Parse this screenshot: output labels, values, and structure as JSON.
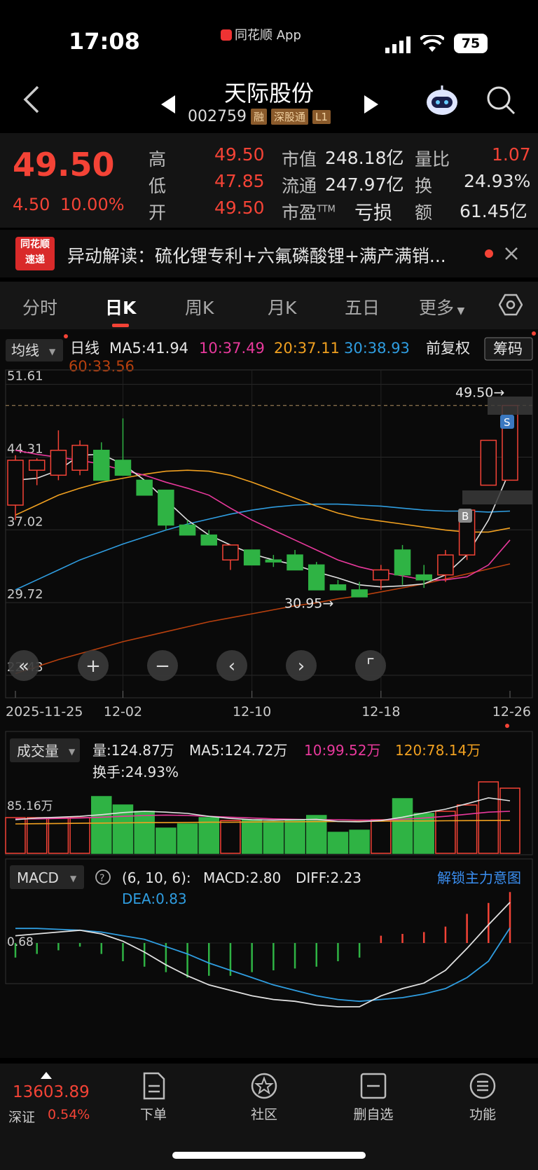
{
  "status_bar": {
    "time": "17:08",
    "app_label": "同花顺 App",
    "battery": "75"
  },
  "header": {
    "stock_name": "天际股份",
    "code": "002759",
    "tags": [
      "融",
      "深股通",
      "L1"
    ]
  },
  "quote": {
    "price": "49.50",
    "change": "4.50",
    "change_pct": "10.00%",
    "high_label": "高",
    "high": "49.50",
    "low_label": "低",
    "low": "47.85",
    "open_label": "开",
    "open": "49.50",
    "mktcap_label": "市值",
    "mktcap": "248.18亿",
    "float_label": "流通",
    "float": "247.97亿",
    "pe_label": "市盈",
    "pe_sup": "TTM",
    "pe": "亏损",
    "volratio_label": "量比",
    "volratio": "1.07",
    "turnover_label": "换",
    "turnover": "24.93%",
    "amount_label": "额",
    "amount": "61.45亿"
  },
  "banner": {
    "logo_top": "同花顺",
    "logo_bottom": "速递",
    "text": "异动解读：硫化锂专利+六氟磷酸锂+满产满销..."
  },
  "tabs": [
    "分时",
    "日K",
    "周K",
    "月K",
    "五日",
    "更多"
  ],
  "chart_header": {
    "indicator": "均线",
    "period": "日线",
    "ma5": "MA5:41.94",
    "ma10": "10:37.49",
    "ma20": "20:37.11",
    "ma30": "30:38.93",
    "ma60": "60:33.56",
    "adjust": "前复权",
    "chips": "筹码"
  },
  "price_axis": [
    "51.61",
    "44.31",
    "37.02",
    "29.72",
    "22.43"
  ],
  "price_marks": {
    "high_label": "49.50→",
    "low_label": "30.95→",
    "sell_marker": "S",
    "buy_marker": "B"
  },
  "date_axis": [
    "2025-11-25",
    "12-02",
    "12-10",
    "12-18",
    "12-26"
  ],
  "volume_header": {
    "indicator": "成交量",
    "vol": "量:124.87万",
    "ma5": "MA5:124.72万",
    "ma10": "10:99.52万",
    "ma120": "120:78.14万",
    "turnover": "换手:24.93%",
    "axis_label": "85.16万"
  },
  "macd_header": {
    "indicator": "MACD",
    "params": "(6, 10, 6):",
    "macd": "MACD:2.80",
    "diff": "DIFF:2.23",
    "dea": "DEA:0.83",
    "unlock": "解锁主力意图",
    "axis_label": "0.68"
  },
  "bottom_bar": {
    "index_value": "13603.89",
    "index_name": "深证",
    "index_pct": "0.54%",
    "items": [
      "下单",
      "社区",
      "删自选",
      "功能"
    ]
  },
  "colors": {
    "up": "#f44336",
    "down": "#2fb344",
    "ma5": "#e0e0e0",
    "ma10": "#e8399c",
    "ma20": "#f0a020",
    "ma30": "#2f9de0",
    "ma60": "#b8400e"
  },
  "chart_data": {
    "type": "candlestick",
    "dates": [
      "11-25",
      "11-26",
      "11-27",
      "11-28",
      "12-01",
      "12-02",
      "12-03",
      "12-04",
      "12-05",
      "12-08",
      "12-09",
      "12-10",
      "12-11",
      "12-12",
      "12-15",
      "12-16",
      "12-17",
      "12-18",
      "12-19",
      "12-22",
      "12-23",
      "12-24",
      "12-25",
      "12-26"
    ],
    "ohlc": [
      [
        39.5,
        44.5,
        38.0,
        44.0
      ],
      [
        43.0,
        44.2,
        41.5,
        44.0
      ],
      [
        42.5,
        47.0,
        42.0,
        45.0
      ],
      [
        43.0,
        46.0,
        42.5,
        45.5
      ],
      [
        45.0,
        45.8,
        42.0,
        42.0
      ],
      [
        44.0,
        48.2,
        42.5,
        42.5
      ],
      [
        42.0,
        42.0,
        40.5,
        40.5
      ],
      [
        41.0,
        41.0,
        37.0,
        37.5
      ],
      [
        37.5,
        38.0,
        36.5,
        36.5
      ],
      [
        36.5,
        37.0,
        35.5,
        35.5
      ],
      [
        34.0,
        35.5,
        33.0,
        35.5
      ],
      [
        35.0,
        35.0,
        33.5,
        33.5
      ],
      [
        34.0,
        34.5,
        33.3,
        33.8
      ],
      [
        34.5,
        35.0,
        33.0,
        33.0
      ],
      [
        33.5,
        33.8,
        31.0,
        31.0
      ],
      [
        31.5,
        32.0,
        30.95,
        31.0
      ],
      [
        31.0,
        31.8,
        30.3,
        30.3
      ],
      [
        32.0,
        33.5,
        31.0,
        33.0
      ],
      [
        35.0,
        35.5,
        31.5,
        32.5
      ],
      [
        32.5,
        33.5,
        31.2,
        32.0
      ],
      [
        32.5,
        35.0,
        31.8,
        34.5
      ],
      [
        34.5,
        39.0,
        34.0,
        39.0
      ],
      [
        41.5,
        46.0,
        41.5,
        46.0
      ],
      [
        42.0,
        49.5,
        42.0,
        49.5
      ]
    ],
    "ma5": [
      42.0,
      42.2,
      43.0,
      44.5,
      44.6,
      43.6,
      42.0,
      40.0,
      38.0,
      36.5,
      35.5,
      34.6,
      34.0,
      33.5,
      32.8,
      32.2,
      31.5,
      31.3,
      31.4,
      31.6,
      32.5,
      34.5,
      38.0,
      43.0
    ],
    "ma10": [
      45.0,
      44.6,
      44.3,
      44.0,
      43.6,
      43.0,
      42.5,
      41.8,
      41.2,
      40.5,
      39.2,
      38.0,
      37.0,
      36.0,
      35.0,
      34.0,
      33.3,
      32.8,
      32.4,
      32.0,
      32.0,
      32.3,
      33.5,
      36.0
    ],
    "ma20": [
      38.5,
      39.5,
      40.5,
      41.2,
      41.8,
      42.2,
      42.6,
      42.9,
      43.0,
      42.9,
      42.5,
      41.8,
      41.0,
      40.2,
      39.4,
      38.7,
      38.2,
      37.9,
      37.6,
      37.3,
      37.0,
      36.8,
      36.8,
      37.2
    ],
    "ma30": [
      31.0,
      32.0,
      33.0,
      34.0,
      34.8,
      35.6,
      36.3,
      37.0,
      37.6,
      38.1,
      38.6,
      39.0,
      39.3,
      39.5,
      39.6,
      39.6,
      39.5,
      39.4,
      39.2,
      39.0,
      38.9,
      38.9,
      38.8,
      38.9
    ],
    "ma60": [
      22.6,
      23.3,
      24.0,
      24.6,
      25.2,
      25.8,
      26.3,
      26.8,
      27.3,
      27.8,
      28.2,
      28.6,
      29.0,
      29.4,
      29.7,
      30.1,
      30.4,
      30.8,
      31.2,
      31.6,
      32.1,
      32.6,
      33.1,
      33.6
    ],
    "volume": [
      85,
      85,
      85,
      85,
      135,
      115,
      100,
      60,
      70,
      85,
      78,
      80,
      76,
      80,
      90,
      50,
      55,
      80,
      130,
      95,
      100,
      115,
      170,
      155
    ],
    "volume_ma5": [
      80,
      84,
      86,
      88,
      92,
      97,
      100,
      98,
      95,
      88,
      83,
      80,
      79,
      80,
      81,
      76,
      75,
      78,
      86,
      96,
      105,
      118,
      132,
      125
    ],
    "volume_ma10": [
      82,
      82,
      83,
      84,
      86,
      88,
      90,
      91,
      90,
      88,
      86,
      84,
      82,
      81,
      80,
      80,
      79,
      79,
      81,
      84,
      88,
      93,
      98,
      100
    ],
    "volume_ma120": [
      70,
      70.5,
      71,
      71.5,
      72,
      72.5,
      73,
      73,
      73.5,
      74,
      74,
      74.5,
      75,
      75,
      75.5,
      76,
      76,
      76.5,
      77,
      77,
      77.5,
      77.8,
      78,
      78.14
    ],
    "macd_hist": [
      -0.8,
      -0.6,
      -0.4,
      -0.2,
      -0.6,
      -1.0,
      -1.3,
      -1.6,
      -1.9,
      -1.8,
      -1.8,
      -1.6,
      -1.5,
      -1.4,
      -1.3,
      -1.0,
      -0.8,
      0.4,
      0.5,
      0.6,
      0.9,
      1.6,
      2.2,
      2.8
    ],
    "diff": [
      0.4,
      0.5,
      0.6,
      0.7,
      0.5,
      0.1,
      -0.5,
      -1.2,
      -1.8,
      -2.3,
      -2.6,
      -2.9,
      -3.1,
      -3.2,
      -3.4,
      -3.5,
      -3.5,
      -2.9,
      -2.5,
      -2.2,
      -1.5,
      -0.3,
      1.0,
      2.23
    ],
    "dea": [
      0.8,
      0.8,
      0.75,
      0.7,
      0.6,
      0.4,
      0.2,
      -0.2,
      -0.6,
      -1.1,
      -1.5,
      -1.9,
      -2.3,
      -2.6,
      -2.9,
      -3.1,
      -3.2,
      -3.1,
      -3.0,
      -2.8,
      -2.5,
      -1.9,
      -1.0,
      0.83
    ]
  }
}
